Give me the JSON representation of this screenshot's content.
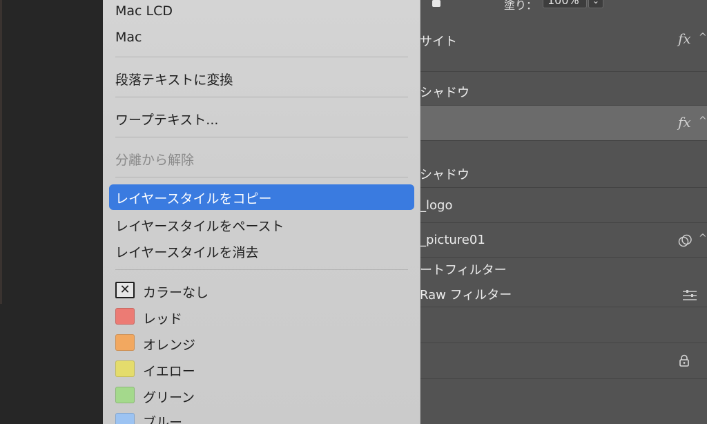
{
  "fill_bar": {
    "label": "塗り：",
    "value": "100%",
    "dropdown_icon": "chevron-down-icon"
  },
  "layers": [
    {
      "text": "サイト",
      "fx": "fx",
      "chevron": "^"
    },
    {
      "text": "シャドウ"
    },
    {
      "text": "",
      "fx": "fx",
      "chevron": "^"
    },
    {
      "text": "シャドウ"
    },
    {
      "text": "_logo"
    },
    {
      "text": "_picture01",
      "chevron": "^"
    },
    {
      "text": "ートフィルター"
    },
    {
      "text": "Raw フィルター"
    },
    {
      "text": ""
    },
    {
      "text": ""
    }
  ],
  "menu": {
    "items": {
      "mac_lcd": "Mac LCD",
      "mac": "Mac",
      "convert_paragraph": "段落テキストに変換",
      "warp_text": "ワープテキスト...",
      "release_isolation": "分離から解除",
      "copy_layer_style": "レイヤースタイルをコピー",
      "paste_layer_style": "レイヤースタイルをペースト",
      "clear_layer_style": "レイヤースタイルを消去"
    },
    "colors": [
      {
        "label": "カラーなし",
        "color": null
      },
      {
        "label": "レッド",
        "color": "#ec7b74"
      },
      {
        "label": "オレンジ",
        "color": "#f2a860"
      },
      {
        "label": "イエロー",
        "color": "#e4dc6c"
      },
      {
        "label": "グリーン",
        "color": "#a4d98c"
      },
      {
        "label": "ブルー",
        "color": "#9cc3f2"
      }
    ],
    "highlight_color": "#3a7be0"
  }
}
